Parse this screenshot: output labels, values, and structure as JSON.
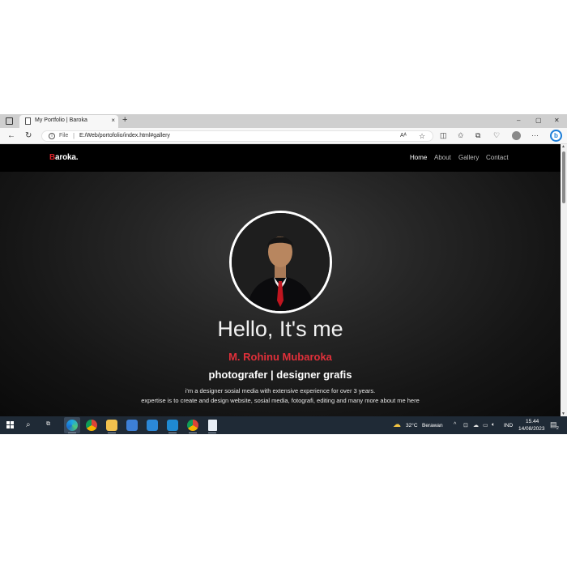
{
  "browser": {
    "tab_title": "My Portfolio | Baroka",
    "tab_close": "×",
    "new_tab": "+",
    "url_scheme": "File",
    "url": "E:/Web/portofolio/index.html#gallery",
    "window_controls": [
      "–",
      "▢",
      "✕"
    ]
  },
  "site": {
    "logo_first": "B",
    "logo_rest": "aroka.",
    "nav": [
      "Home",
      "About",
      "Gallery",
      "Contact"
    ],
    "active_nav": "Home",
    "greeting": "Hello, It's me",
    "name": "M. Rohinu Mubaroka",
    "role": "photografer | designer grafis",
    "description_line1": "i'm a designer sosial media with extensive experience for over 3 years.",
    "description_line2": "expertise is to create and design website, sosial media, fotografi, editing and many more about me here"
  },
  "taskbar": {
    "weather_temp": "32°C",
    "weather_text": "Berawan",
    "language": "IND",
    "time": "15.44",
    "date": "14/08/2023",
    "notification_count": "2"
  },
  "colors": {
    "accent_red": "#e0303a",
    "taskbar": "#1f2a36",
    "page_bg": "#151515"
  }
}
